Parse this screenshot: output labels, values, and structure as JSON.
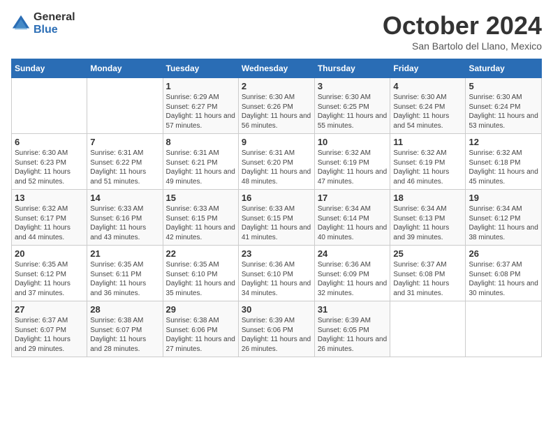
{
  "logo": {
    "general": "General",
    "blue": "Blue"
  },
  "title": "October 2024",
  "subtitle": "San Bartolo del Llano, Mexico",
  "headers": [
    "Sunday",
    "Monday",
    "Tuesday",
    "Wednesday",
    "Thursday",
    "Friday",
    "Saturday"
  ],
  "weeks": [
    [
      {
        "day": "",
        "info": ""
      },
      {
        "day": "",
        "info": ""
      },
      {
        "day": "1",
        "info": "Sunrise: 6:29 AM\nSunset: 6:27 PM\nDaylight: 11 hours and 57 minutes."
      },
      {
        "day": "2",
        "info": "Sunrise: 6:30 AM\nSunset: 6:26 PM\nDaylight: 11 hours and 56 minutes."
      },
      {
        "day": "3",
        "info": "Sunrise: 6:30 AM\nSunset: 6:25 PM\nDaylight: 11 hours and 55 minutes."
      },
      {
        "day": "4",
        "info": "Sunrise: 6:30 AM\nSunset: 6:24 PM\nDaylight: 11 hours and 54 minutes."
      },
      {
        "day": "5",
        "info": "Sunrise: 6:30 AM\nSunset: 6:24 PM\nDaylight: 11 hours and 53 minutes."
      }
    ],
    [
      {
        "day": "6",
        "info": "Sunrise: 6:30 AM\nSunset: 6:23 PM\nDaylight: 11 hours and 52 minutes."
      },
      {
        "day": "7",
        "info": "Sunrise: 6:31 AM\nSunset: 6:22 PM\nDaylight: 11 hours and 51 minutes."
      },
      {
        "day": "8",
        "info": "Sunrise: 6:31 AM\nSunset: 6:21 PM\nDaylight: 11 hours and 49 minutes."
      },
      {
        "day": "9",
        "info": "Sunrise: 6:31 AM\nSunset: 6:20 PM\nDaylight: 11 hours and 48 minutes."
      },
      {
        "day": "10",
        "info": "Sunrise: 6:32 AM\nSunset: 6:19 PM\nDaylight: 11 hours and 47 minutes."
      },
      {
        "day": "11",
        "info": "Sunrise: 6:32 AM\nSunset: 6:19 PM\nDaylight: 11 hours and 46 minutes."
      },
      {
        "day": "12",
        "info": "Sunrise: 6:32 AM\nSunset: 6:18 PM\nDaylight: 11 hours and 45 minutes."
      }
    ],
    [
      {
        "day": "13",
        "info": "Sunrise: 6:32 AM\nSunset: 6:17 PM\nDaylight: 11 hours and 44 minutes."
      },
      {
        "day": "14",
        "info": "Sunrise: 6:33 AM\nSunset: 6:16 PM\nDaylight: 11 hours and 43 minutes."
      },
      {
        "day": "15",
        "info": "Sunrise: 6:33 AM\nSunset: 6:15 PM\nDaylight: 11 hours and 42 minutes."
      },
      {
        "day": "16",
        "info": "Sunrise: 6:33 AM\nSunset: 6:15 PM\nDaylight: 11 hours and 41 minutes."
      },
      {
        "day": "17",
        "info": "Sunrise: 6:34 AM\nSunset: 6:14 PM\nDaylight: 11 hours and 40 minutes."
      },
      {
        "day": "18",
        "info": "Sunrise: 6:34 AM\nSunset: 6:13 PM\nDaylight: 11 hours and 39 minutes."
      },
      {
        "day": "19",
        "info": "Sunrise: 6:34 AM\nSunset: 6:12 PM\nDaylight: 11 hours and 38 minutes."
      }
    ],
    [
      {
        "day": "20",
        "info": "Sunrise: 6:35 AM\nSunset: 6:12 PM\nDaylight: 11 hours and 37 minutes."
      },
      {
        "day": "21",
        "info": "Sunrise: 6:35 AM\nSunset: 6:11 PM\nDaylight: 11 hours and 36 minutes."
      },
      {
        "day": "22",
        "info": "Sunrise: 6:35 AM\nSunset: 6:10 PM\nDaylight: 11 hours and 35 minutes."
      },
      {
        "day": "23",
        "info": "Sunrise: 6:36 AM\nSunset: 6:10 PM\nDaylight: 11 hours and 34 minutes."
      },
      {
        "day": "24",
        "info": "Sunrise: 6:36 AM\nSunset: 6:09 PM\nDaylight: 11 hours and 32 minutes."
      },
      {
        "day": "25",
        "info": "Sunrise: 6:37 AM\nSunset: 6:08 PM\nDaylight: 11 hours and 31 minutes."
      },
      {
        "day": "26",
        "info": "Sunrise: 6:37 AM\nSunset: 6:08 PM\nDaylight: 11 hours and 30 minutes."
      }
    ],
    [
      {
        "day": "27",
        "info": "Sunrise: 6:37 AM\nSunset: 6:07 PM\nDaylight: 11 hours and 29 minutes."
      },
      {
        "day": "28",
        "info": "Sunrise: 6:38 AM\nSunset: 6:07 PM\nDaylight: 11 hours and 28 minutes."
      },
      {
        "day": "29",
        "info": "Sunrise: 6:38 AM\nSunset: 6:06 PM\nDaylight: 11 hours and 27 minutes."
      },
      {
        "day": "30",
        "info": "Sunrise: 6:39 AM\nSunset: 6:06 PM\nDaylight: 11 hours and 26 minutes."
      },
      {
        "day": "31",
        "info": "Sunrise: 6:39 AM\nSunset: 6:05 PM\nDaylight: 11 hours and 26 minutes."
      },
      {
        "day": "",
        "info": ""
      },
      {
        "day": "",
        "info": ""
      }
    ]
  ]
}
